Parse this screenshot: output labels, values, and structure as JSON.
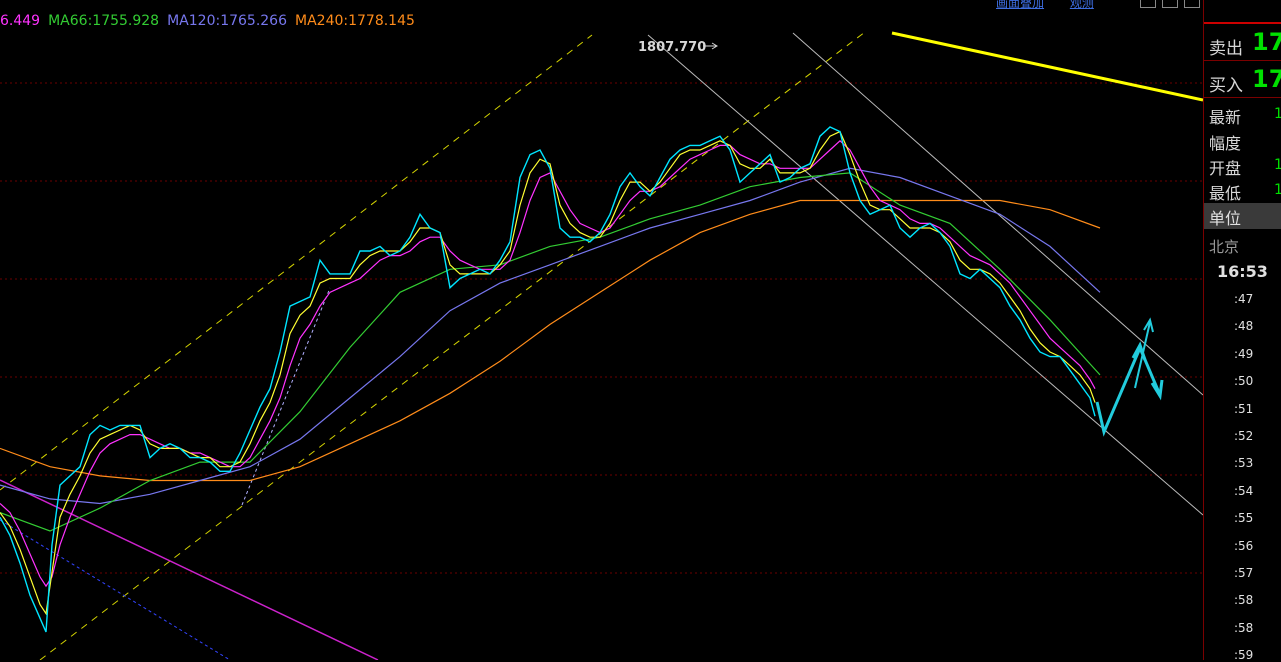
{
  "legend": {
    "items": [
      {
        "label": "6.449",
        "color": "#ff33ff"
      },
      {
        "label": "MA66:1755.928",
        "color": "#33cc33"
      },
      {
        "label": "MA120:1765.266",
        "color": "#7777ee"
      },
      {
        "label": "MA240:1778.145",
        "color": "#ff8c1a"
      }
    ]
  },
  "top_links": [
    "画面叠加",
    "观测"
  ],
  "chart_data": {
    "type": "line",
    "title": "",
    "peak_annotation": "1807.770",
    "price_range": [
      1700,
      1820
    ],
    "grid": true,
    "series": [
      {
        "name": "",
        "color": "#00e5ff",
        "x": [
          0,
          10,
          20,
          30,
          40,
          46,
          52,
          60,
          70,
          80,
          90,
          100,
          110,
          120,
          130,
          140,
          150,
          160,
          170,
          180,
          190,
          200,
          210,
          220,
          230,
          240,
          250,
          260,
          270,
          280,
          290,
          300,
          310,
          320,
          330,
          340,
          350,
          360,
          370,
          380,
          390,
          400,
          410,
          420,
          430,
          440,
          450,
          460,
          470,
          480,
          490,
          500,
          510,
          520,
          530,
          540,
          550,
          560,
          570,
          580,
          590,
          600,
          610,
          620,
          630,
          640,
          650,
          660,
          670,
          680,
          690,
          700,
          710,
          720,
          730,
          740,
          750,
          760,
          770,
          780,
          790,
          800,
          810,
          820,
          830,
          840,
          850,
          860,
          870,
          880,
          890,
          900,
          910,
          920,
          930,
          940,
          950,
          960,
          970,
          980,
          990,
          1000,
          1010,
          1020,
          1030,
          1040,
          1050,
          1060,
          1070,
          1080,
          1090,
          1095
        ],
        "y": [
          1711,
          1707,
          1701,
          1694,
          1689,
          1686,
          1705,
          1718,
          1720,
          1722,
          1729,
          1731,
          1730,
          1731,
          1731,
          1731,
          1724,
          1726,
          1727,
          1726,
          1724,
          1724,
          1723,
          1721,
          1721,
          1725,
          1730,
          1735,
          1739,
          1747,
          1757,
          1758,
          1759,
          1767,
          1764,
          1764,
          1764,
          1769,
          1769,
          1770,
          1768,
          1769,
          1772,
          1777,
          1774,
          1773,
          1761,
          1763,
          1764,
          1765,
          1764,
          1767,
          1771,
          1785,
          1790,
          1791,
          1787,
          1774,
          1772,
          1772,
          1771,
          1773,
          1777,
          1783,
          1786,
          1783,
          1781,
          1785,
          1789,
          1791,
          1792,
          1792,
          1793,
          1794,
          1791,
          1784,
          1786,
          1788,
          1790,
          1784,
          1785,
          1787,
          1788,
          1794,
          1796,
          1795,
          1786,
          1780,
          1777,
          1778,
          1779,
          1774,
          1772,
          1774,
          1775,
          1773,
          1770,
          1764,
          1763,
          1765,
          1763,
          1761,
          1757,
          1754,
          1750,
          1747,
          1746,
          1746,
          1743,
          1740,
          1737,
          1733
        ]
      },
      {
        "name": "",
        "color": "#ffff33",
        "x": [
          0,
          10,
          20,
          30,
          40,
          46,
          52,
          60,
          70,
          80,
          90,
          100,
          110,
          120,
          130,
          140,
          150,
          160,
          170,
          180,
          190,
          200,
          210,
          220,
          230,
          240,
          250,
          260,
          270,
          280,
          290,
          300,
          310,
          320,
          330,
          340,
          350,
          360,
          370,
          380,
          390,
          400,
          410,
          420,
          430,
          440,
          450,
          460,
          470,
          480,
          490,
          500,
          510,
          520,
          530,
          540,
          550,
          560,
          570,
          580,
          590,
          600,
          610,
          620,
          630,
          640,
          650,
          660,
          670,
          680,
          690,
          700,
          710,
          720,
          730,
          740,
          750,
          760,
          770,
          780,
          790,
          800,
          810,
          820,
          830,
          840,
          850,
          860,
          870,
          880,
          890,
          900,
          910,
          920,
          930,
          940,
          950,
          960,
          970,
          980,
          990,
          1000,
          1010,
          1020,
          1030,
          1040,
          1050,
          1060,
          1070,
          1080,
          1090,
          1095
        ],
        "y": [
          1712,
          1709,
          1704,
          1698,
          1692,
          1690,
          1699,
          1711,
          1716,
          1720,
          1725,
          1728,
          1729,
          1730,
          1731,
          1730,
          1727,
          1726,
          1726,
          1726,
          1725,
          1724,
          1724,
          1722,
          1722,
          1723,
          1727,
          1732,
          1736,
          1742,
          1751,
          1755,
          1757,
          1762,
          1763,
          1763,
          1763,
          1766,
          1768,
          1769,
          1769,
          1769,
          1771,
          1774,
          1774,
          1773,
          1766,
          1764,
          1764,
          1764,
          1764,
          1766,
          1769,
          1779,
          1786,
          1789,
          1788,
          1779,
          1775,
          1773,
          1772,
          1772,
          1775,
          1780,
          1784,
          1784,
          1782,
          1784,
          1787,
          1790,
          1791,
          1791,
          1792,
          1793,
          1792,
          1788,
          1787,
          1787,
          1789,
          1786,
          1786,
          1786,
          1787,
          1791,
          1794,
          1795,
          1790,
          1784,
          1779,
          1778,
          1778,
          1776,
          1774,
          1774,
          1774,
          1773,
          1771,
          1767,
          1765,
          1765,
          1764,
          1762,
          1759,
          1756,
          1752,
          1749,
          1747,
          1746,
          1744,
          1742,
          1739,
          1736
        ]
      },
      {
        "name": "",
        "color": "#ff33ff",
        "x": [
          0,
          10,
          20,
          30,
          40,
          46,
          52,
          60,
          70,
          80,
          90,
          100,
          110,
          120,
          130,
          140,
          150,
          160,
          170,
          180,
          190,
          200,
          210,
          220,
          230,
          240,
          250,
          260,
          270,
          280,
          290,
          300,
          310,
          320,
          330,
          340,
          350,
          360,
          370,
          380,
          390,
          400,
          410,
          420,
          430,
          440,
          450,
          460,
          470,
          480,
          490,
          500,
          510,
          520,
          530,
          540,
          550,
          560,
          570,
          580,
          590,
          600,
          610,
          620,
          630,
          640,
          650,
          660,
          670,
          680,
          690,
          700,
          710,
          720,
          730,
          740,
          750,
          760,
          770,
          780,
          790,
          800,
          810,
          820,
          830,
          840,
          850,
          860,
          870,
          880,
          890,
          900,
          910,
          920,
          930,
          940,
          950,
          960,
          970,
          980,
          990,
          1000,
          1010,
          1020,
          1030,
          1040,
          1050,
          1060,
          1070,
          1080,
          1090,
          1095
        ],
        "y": [
          1714,
          1712,
          1708,
          1703,
          1698,
          1696,
          1698,
          1705,
          1711,
          1716,
          1721,
          1725,
          1727,
          1728,
          1729,
          1729,
          1728,
          1727,
          1726,
          1726,
          1725,
          1725,
          1724,
          1723,
          1722,
          1722,
          1724,
          1728,
          1732,
          1737,
          1744,
          1750,
          1753,
          1757,
          1760,
          1761,
          1762,
          1763,
          1765,
          1767,
          1768,
          1768,
          1769,
          1771,
          1772,
          1772,
          1769,
          1767,
          1766,
          1765,
          1765,
          1765,
          1767,
          1773,
          1780,
          1785,
          1786,
          1782,
          1778,
          1775,
          1774,
          1773,
          1774,
          1777,
          1780,
          1782,
          1782,
          1783,
          1785,
          1787,
          1789,
          1790,
          1791,
          1792,
          1792,
          1790,
          1789,
          1788,
          1788,
          1787,
          1787,
          1787,
          1787,
          1789,
          1791,
          1793,
          1791,
          1787,
          1783,
          1780,
          1779,
          1778,
          1776,
          1775,
          1775,
          1774,
          1772,
          1770,
          1768,
          1767,
          1766,
          1764,
          1762,
          1759,
          1756,
          1753,
          1750,
          1748,
          1746,
          1744,
          1741,
          1739
        ]
      },
      {
        "name": "",
        "color": "#33cc33",
        "x": [
          0,
          50,
          100,
          150,
          200,
          250,
          300,
          350,
          400,
          450,
          500,
          550,
          600,
          650,
          700,
          750,
          800,
          850,
          900,
          950,
          1000,
          1050,
          1100
        ],
        "y": [
          1712,
          1708,
          1713,
          1719,
          1723,
          1723,
          1734,
          1748,
          1760,
          1765,
          1766,
          1770,
          1772,
          1776,
          1779,
          1783,
          1785,
          1786,
          1779,
          1775,
          1765,
          1754,
          1742
        ]
      },
      {
        "name": "",
        "color": "#7777ee",
        "x": [
          0,
          50,
          100,
          150,
          200,
          250,
          300,
          350,
          400,
          450,
          500,
          550,
          600,
          650,
          700,
          750,
          800,
          850,
          900,
          950,
          1000,
          1050,
          1100
        ],
        "y": [
          1718,
          1715,
          1714,
          1716,
          1719,
          1722,
          1728,
          1737,
          1746,
          1756,
          1762,
          1766,
          1770,
          1774,
          1777,
          1780,
          1784,
          1787,
          1785,
          1781,
          1777,
          1770,
          1760
        ]
      },
      {
        "name": "",
        "color": "#ff8c1a",
        "x": [
          0,
          50,
          100,
          150,
          200,
          250,
          300,
          350,
          400,
          450,
          500,
          550,
          600,
          650,
          700,
          750,
          800,
          850,
          900,
          950,
          1000,
          1050,
          1100
        ],
        "y": [
          1726,
          1722,
          1720,
          1719,
          1719,
          1719,
          1722,
          1727,
          1732,
          1738,
          1745,
          1753,
          1760,
          1767,
          1773,
          1777,
          1780,
          1780,
          1780,
          1780,
          1780,
          1778,
          1774
        ]
      }
    ]
  },
  "panel": {
    "sell_label": "卖出",
    "sell_value": "17",
    "buy_label": "买入",
    "buy_value": "17",
    "latest_label": "最新",
    "latest_value": "1",
    "change_label": "幅度",
    "open_label": "开盘",
    "open_value": "1",
    "low_label": "最低",
    "low_value": "1",
    "unit_label": "单位",
    "city": "北京",
    "time": "16:53",
    "ticks": [
      ":47",
      ":48",
      ":49",
      ":50",
      ":51",
      ":52",
      ":53",
      ":54",
      ":55",
      ":56",
      ":57",
      ":58",
      ":58",
      ":59"
    ]
  }
}
